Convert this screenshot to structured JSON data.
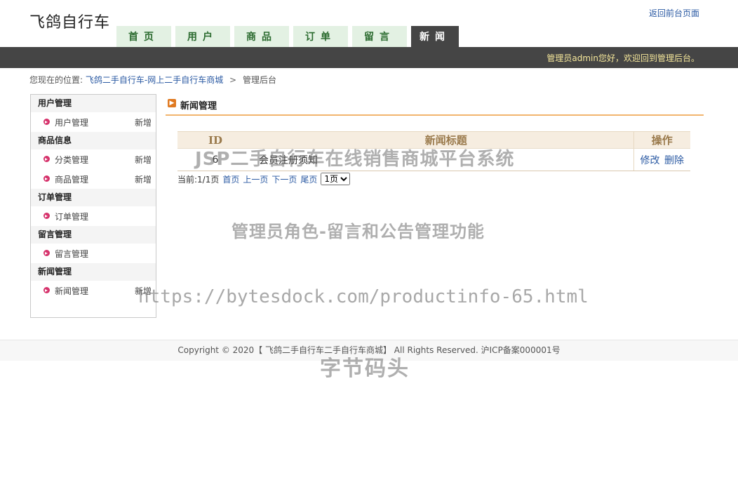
{
  "header": {
    "site_title": "飞鸽自行车",
    "back_link": "返回前台页面",
    "nav_tabs": [
      {
        "label": "首页",
        "active": false
      },
      {
        "label": "用户",
        "active": false
      },
      {
        "label": "商品",
        "active": false
      },
      {
        "label": "订单",
        "active": false
      },
      {
        "label": "留言",
        "active": false
      },
      {
        "label": "新闻",
        "active": true
      }
    ],
    "welcome": "管理员admin您好，欢迎回到管理后台。"
  },
  "breadcrumb": {
    "prefix": "您现在的位置:",
    "site_link": "飞鸽二手自行车-网上二手自行车商城",
    "separator": ">",
    "current": "管理后台"
  },
  "sidebar": {
    "groups": [
      {
        "title": "用户管理",
        "items": [
          {
            "label": "用户管理",
            "add": "新增"
          }
        ]
      },
      {
        "title": "商品信息",
        "items": [
          {
            "label": "分类管理",
            "add": "新增"
          },
          {
            "label": "商品管理",
            "add": "新增"
          }
        ]
      },
      {
        "title": "订单管理",
        "items": [
          {
            "label": "订单管理",
            "add": ""
          }
        ]
      },
      {
        "title": "留言管理",
        "items": [
          {
            "label": "留言管理",
            "add": ""
          }
        ]
      },
      {
        "title": "新闻管理",
        "items": [
          {
            "label": "新闻管理",
            "add": "新增"
          }
        ]
      }
    ]
  },
  "main": {
    "section_title": "新闻管理",
    "table": {
      "headers": [
        "ID",
        "新闻标题",
        "操作"
      ],
      "rows": [
        {
          "id": "6",
          "title": "会员注册须知",
          "edit": "修改",
          "delete": "删除"
        }
      ]
    },
    "pager": {
      "status": "当前:1/1页",
      "first": "首页",
      "prev": "上一页",
      "next": "下一页",
      "last": "尾页",
      "select_value": "1页"
    }
  },
  "watermarks": {
    "line1": "JSP二手自行车在线销售商城平台系统",
    "line2": "管理员角色-留言和公告管理功能",
    "line3": "https://bytesdock.com/productinfo-65.html",
    "line4": "字节码头"
  },
  "footer": {
    "text": "Copyright © 2020【 飞鸽二手自行车二手自行车商城】 All Rights Reserved. 沪ICP备案000001号"
  }
}
